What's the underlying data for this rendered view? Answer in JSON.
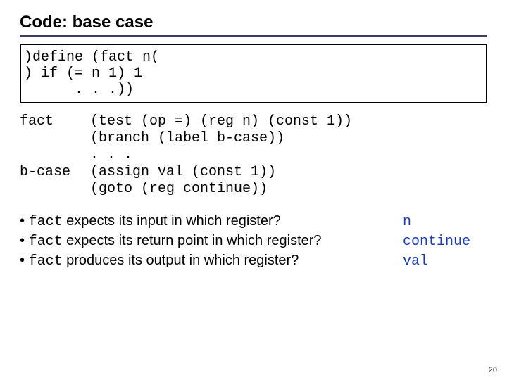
{
  "title": "Code: base case",
  "code_block": ")define (fact n(\n) if (= n 1) 1\n      . . .))",
  "asm_rows": [
    {
      "label": "fact",
      "instr": "(test (op =) (reg n) (const 1))"
    },
    {
      "label": "",
      "instr": "(branch (label b-case))"
    },
    {
      "label": "",
      "instr": ". . ."
    },
    {
      "label": "b-case",
      "instr": "(assign val (const 1))"
    },
    {
      "label": "",
      "instr": "(goto (reg continue))"
    }
  ],
  "bullets": [
    {
      "pre": "fact",
      "post": " expects its input in which register?",
      "answer": "n"
    },
    {
      "pre": "fact",
      "post": " expects its return point in which register?",
      "answer": "continue"
    },
    {
      "pre": "fact",
      "post": " produces its output in which register?",
      "answer": "val"
    }
  ],
  "pagenum": "20"
}
